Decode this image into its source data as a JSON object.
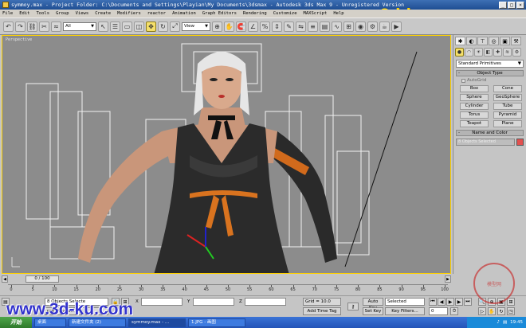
{
  "window": {
    "title": "symmoy.max  - Project Folder: C:\\Documents and Settings\\Playian\\My Documents\\3dsmax  - Autodesk 3ds Max 9  - Unregistered Version",
    "min": "_",
    "max": "□",
    "close": "×"
  },
  "watermark": {
    "top": "www.3d-ku.com",
    "bottom": "www.3d-ku.com",
    "seal": "模型网"
  },
  "menu": [
    "File",
    "Edit",
    "Tools",
    "Group",
    "Views",
    "Create",
    "Modifiers",
    "reactor",
    "Animation",
    "Graph Editors",
    "Rendering",
    "Customize",
    "MAXScript",
    "Help"
  ],
  "toolbar": {
    "selection_filter": "All",
    "ref_coord": "View",
    "icons_left": [
      "undo-icon",
      "redo-icon",
      "link-icon",
      "unlink-icon",
      "bind-spacewarp-icon"
    ],
    "icons_mid": [
      "select-object-icon",
      "select-by-name-icon",
      "rect-region-icon",
      "window-crossing-icon",
      "move-icon",
      "rotate-icon",
      "scale-icon"
    ],
    "icons_right": [
      "pivot-icon",
      "manipulate-icon",
      "snap-icon",
      "angle-snap-icon",
      "percent-snap-icon",
      "spinner-snap-icon",
      "named-sets-icon",
      "mirror-icon",
      "align-icon",
      "layer-icon",
      "curve-editor-icon",
      "schematic-icon",
      "material-editor-icon",
      "render-setup-icon",
      "render-icon",
      "quick-render-icon"
    ]
  },
  "viewport": {
    "label": "Perspective"
  },
  "command_panel": {
    "primitive_type": "Standard Primitives",
    "object_type_title": "Object Type",
    "autogrid": "AutoGrid",
    "primitives": [
      "Box",
      "Cone",
      "Sphere",
      "GeoSphere",
      "Cylinder",
      "Tube",
      "Torus",
      "Pyramid",
      "Teapot",
      "Plane"
    ],
    "name_color_title": "Name and Color",
    "name_value": "8 Objects Selected",
    "swatch_color": "#e3514f"
  },
  "timeline": {
    "frame_display": "0 / 100",
    "ticks": [
      "0",
      "5",
      "10",
      "15",
      "20",
      "25",
      "30",
      "35",
      "40",
      "45",
      "50",
      "55",
      "60",
      "65",
      "70",
      "75",
      "80",
      "85",
      "90",
      "95",
      "100"
    ]
  },
  "status": {
    "selection": "8 Objects Selecte",
    "prompt": "rag to select",
    "x_label": "X",
    "y_label": "Y",
    "z_label": "Z",
    "grid": "Grid = 10.0",
    "add_time_tag": "Add Time Tag",
    "auto_key": "Auto Key",
    "set_key": "Set Key",
    "key_mode": "Selected",
    "key_filters": "Key Filters...",
    "frame": "0"
  },
  "taskbar": {
    "start": "开始",
    "items": [
      "桌面",
      "新建文件夹 (2)",
      "symmoy.max - ...",
      "1.JPG - 画图"
    ],
    "time": "19:45"
  }
}
